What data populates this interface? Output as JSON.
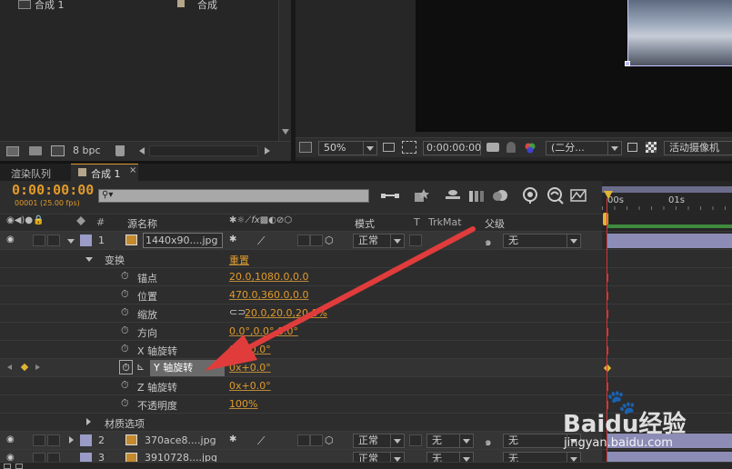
{
  "project": {
    "item_name": "合成 1",
    "item_type": "合成",
    "bpc": "8 bpc"
  },
  "viewer": {
    "zoom": "50%",
    "timecode": "0:00:00:00",
    "resolution": "(二分...",
    "camera": "活动摄像机"
  },
  "tabs": [
    {
      "label": "渲染队列"
    },
    {
      "label": "合成 1"
    }
  ],
  "timeline": {
    "timecode": "0:00:00:00",
    "frame_info": "00001 (25.00 fps)",
    "ruler": [
      "00s",
      "01s"
    ],
    "columns": {
      "source_name": "源名称",
      "mode": "模式",
      "t": "T",
      "trkmat": "TrkMat",
      "parent": "父级",
      "num": "#"
    },
    "layers": [
      {
        "num": "1",
        "name": "1440x90....jpg",
        "mode": "正常",
        "trkmat": "",
        "parent": "无"
      },
      {
        "num": "2",
        "name": "370ace8....jpg",
        "mode": "正常",
        "trkmat": "无",
        "parent": "无"
      },
      {
        "num": "3",
        "name": "3910728....jpg",
        "mode": "正常",
        "trkmat": "无",
        "parent": "无"
      }
    ],
    "transform_group": {
      "label": "变换",
      "reset": "重置"
    },
    "properties": [
      {
        "name": "锚点",
        "value": "20.0,1080.0,0.0"
      },
      {
        "name": "位置",
        "value": "470.0,360.0,0.0"
      },
      {
        "name": "缩放",
        "value": "20.0,20.0,20.0%"
      },
      {
        "name": "方向",
        "value": "0.0°,0.0°,0.0°"
      },
      {
        "name": "X 轴旋转",
        "value": "0x+0.0°"
      },
      {
        "name": "Y 轴旋转",
        "value": "0x+0.0°"
      },
      {
        "name": "Z 轴旋转",
        "value": "0x+0.0°"
      },
      {
        "name": "不透明度",
        "value": "100%"
      }
    ],
    "material_group": {
      "label": "材质选项"
    }
  },
  "watermark": {
    "brand": "Baidu经验",
    "url": "jingyan.baidu.com"
  },
  "colors": {
    "accent": "#e09a2b",
    "arrow": "#e03c3c",
    "label_box": "#9b9bc8"
  }
}
